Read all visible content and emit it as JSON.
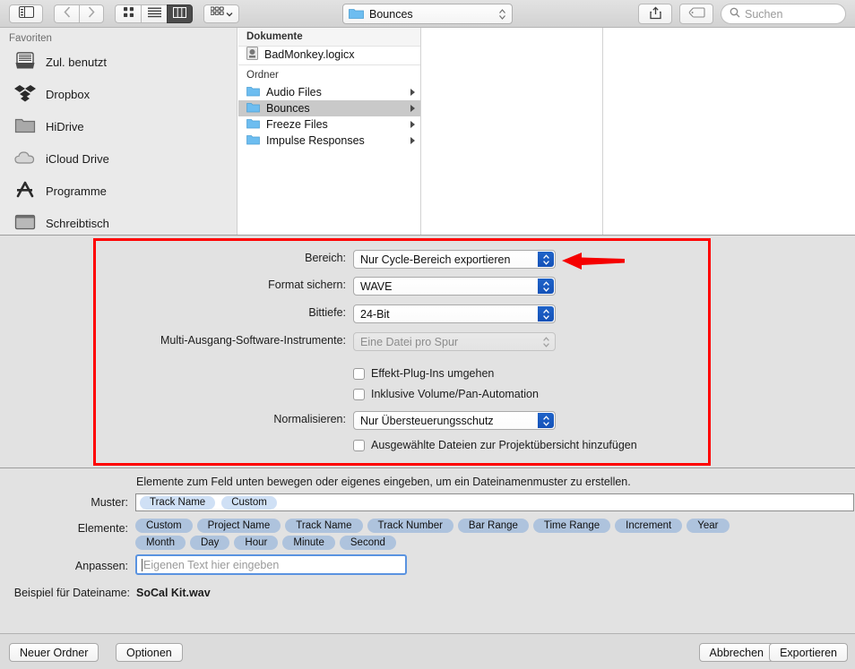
{
  "toolbar": {
    "sidebar_toggle_icon": "sidebar-toggle-icon",
    "back_icon": "chevron-left-icon",
    "forward_icon": "chevron-right-icon",
    "view_icon_grid": "grid-view-icon",
    "view_icon_list": "list-view-icon",
    "view_icon_column": "column-view-icon",
    "arrange_icon": "arrange-icon",
    "path_label": "Bounces",
    "path_folder_icon": "folder-icon",
    "share_icon": "share-icon",
    "tag_icon": "tag-icon",
    "search_icon": "search-icon",
    "search_placeholder": "Suchen"
  },
  "sidebar": {
    "header": "Favoriten",
    "items": [
      {
        "label": "Zul. benutzt",
        "icon": "recents-icon"
      },
      {
        "label": "Dropbox",
        "icon": "dropbox-icon"
      },
      {
        "label": "HiDrive",
        "icon": "folder-gray-icon"
      },
      {
        "label": "iCloud Drive",
        "icon": "cloud-icon"
      },
      {
        "label": "Programme",
        "icon": "applications-icon"
      },
      {
        "label": "Schreibtisch",
        "icon": "desktop-icon"
      }
    ]
  },
  "browser": {
    "documents_header": "Dokumente",
    "documents": [
      {
        "label": "BadMonkey.logicx",
        "icon": "logic-document-icon"
      }
    ],
    "folders_header": "Ordner",
    "folders": [
      {
        "label": "Audio Files",
        "selected": false
      },
      {
        "label": "Bounces",
        "selected": true
      },
      {
        "label": "Freeze Files",
        "selected": false
      },
      {
        "label": "Impulse Responses",
        "selected": false
      }
    ]
  },
  "settings": {
    "rows": [
      {
        "label": "Bereich:",
        "value": "Nur Cycle-Bereich exportieren",
        "disabled": false
      },
      {
        "label": "Format sichern:",
        "value": "WAVE",
        "disabled": false
      },
      {
        "label": "Bittiefe:",
        "value": "24-Bit",
        "disabled": false
      },
      {
        "label": "Multi-Ausgang-Software-Instrumente:",
        "value": "Eine Datei pro Spur",
        "disabled": true
      }
    ],
    "checkbox_bypass": "Effekt-Plug-Ins umgehen",
    "checkbox_automation": "Inklusive Volume/Pan-Automation",
    "normalize_label": "Normalisieren:",
    "normalize_value": "Nur Übersteuerungsschutz",
    "checkbox_project": "Ausgewählte Dateien zur Projektübersicht hinzufügen",
    "highlight_color": "#ff0000",
    "annotation_arrow": "left-arrow-annotation"
  },
  "pattern": {
    "hint": "Elemente zum Feld unten bewegen oder eigenes eingeben, um ein Dateinamenmuster zu erstellen.",
    "muster_label": "Muster:",
    "muster_tokens": [
      "Track Name",
      "Custom"
    ],
    "elemente_label": "Elemente:",
    "elemente_row1": [
      "Custom",
      "Project Name",
      "Track Name",
      "Track Number",
      "Bar Range",
      "Time Range",
      "Increment",
      "Year"
    ],
    "elemente_row2": [
      "Month",
      "Day",
      "Hour",
      "Minute",
      "Second"
    ],
    "anpassen_label": "Anpassen:",
    "anpassen_placeholder": "Eigenen Text hier eingeben",
    "anpassen_value": "",
    "beispiel_label": "Beispiel für Dateiname:",
    "beispiel_value": "SoCal Kit.wav"
  },
  "footer": {
    "new_folder": "Neuer Ordner",
    "options": "Optionen",
    "cancel": "Abbrechen",
    "export": "Exportieren"
  }
}
